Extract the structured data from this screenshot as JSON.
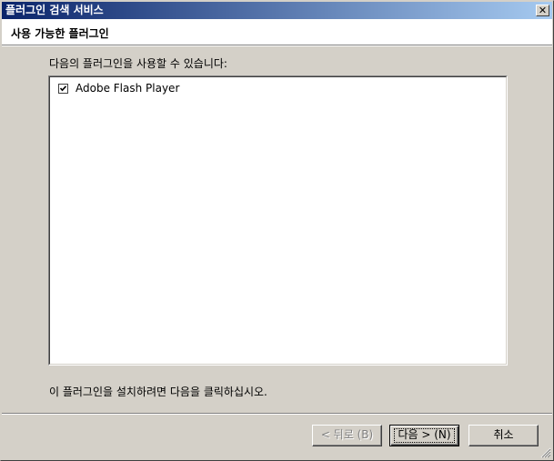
{
  "window": {
    "title": "플러그인 검색 서비스",
    "close_label": "✕"
  },
  "header": {
    "title": "사용 가능한 플러그인"
  },
  "main": {
    "prompt": "다음의 플러그인을 사용할 수 있습니다:",
    "plugins": [
      {
        "label": "Adobe Flash Player",
        "checked": true
      }
    ],
    "instruction": "이 플러그인을 설치하려면 다음을 클릭하십시오."
  },
  "buttons": {
    "back_label": "< 뒤로 (B)",
    "next_label": "다음 > (N)",
    "cancel_label": "취소"
  },
  "colors": {
    "title_gradient_start": "#0a246a",
    "title_gradient_end": "#a6caf0",
    "face": "#d4d0c8"
  }
}
